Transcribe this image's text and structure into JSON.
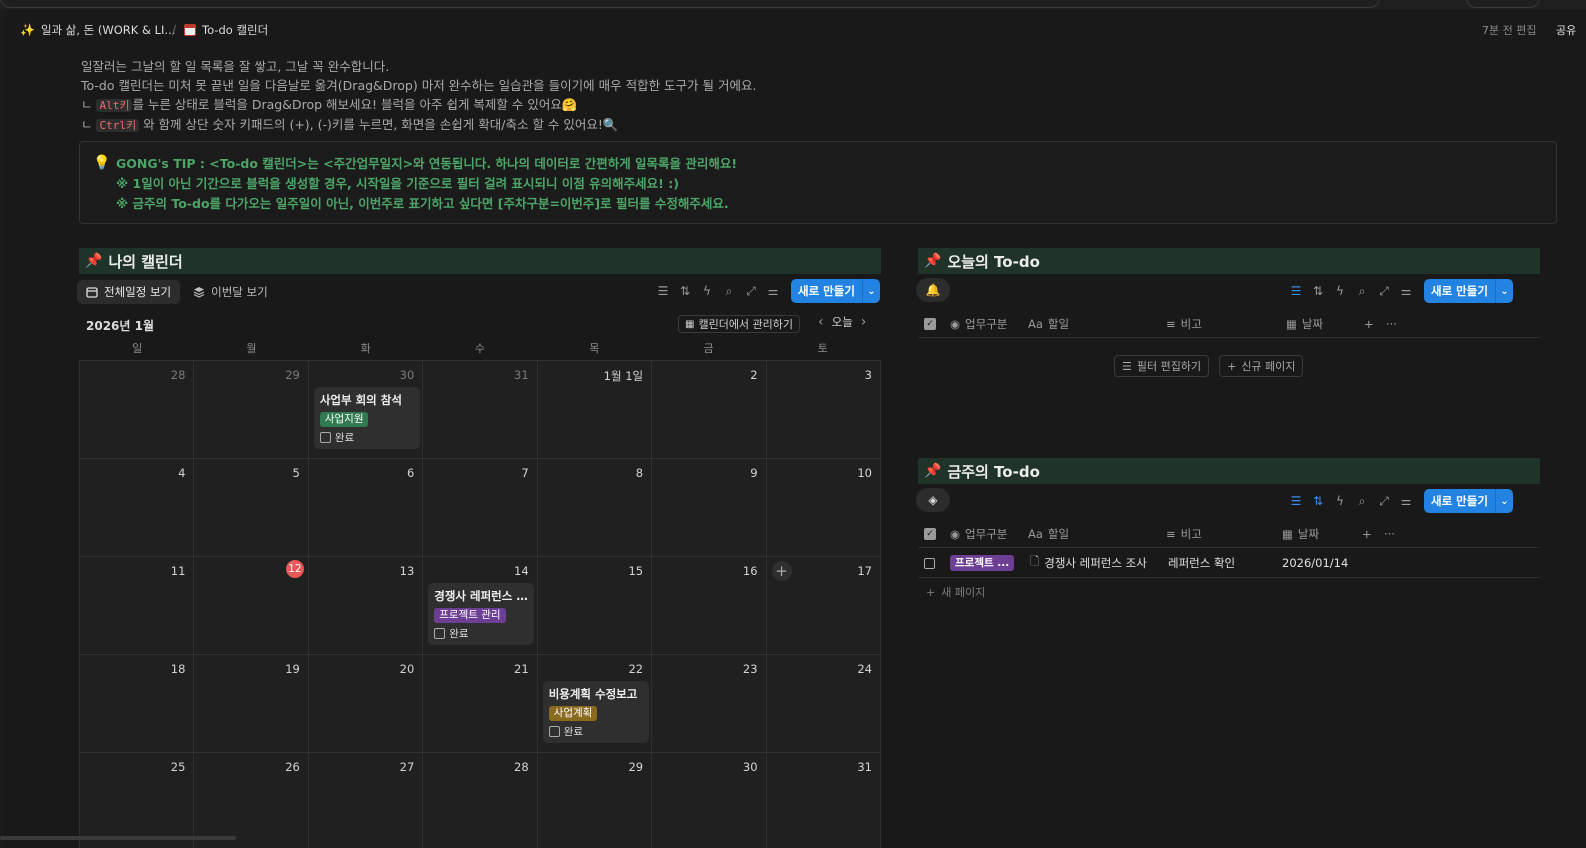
{
  "topbar": {
    "crumb_workspace": "일과 삶, 돈 (WORK & LI...",
    "crumb_sep": "/",
    "crumb_page": "To-do 캘린더",
    "edited": "7분 전 편집",
    "share": "공유"
  },
  "description": {
    "line1": "일잘러는 그날의 할 일 목록을 잘 쌓고, 그날 꼭 완수합니다.",
    "line2": "To-do 캘린더는 미처 못 끝낸 일을 다음날로 옮겨(Drag&Drop) 마저 완수하는 일습관을 들이기에 매우 적합한 도구가 될 거에요.",
    "line3_prefix": "ㄴ ",
    "line3_code": "Alt키",
    "line3_rest": "를 누른 상태로 블럭을 Drag&Drop 해보세요! 블럭을 아주 쉽게 복제할 수 있어요🤗",
    "line4_prefix": "ㄴ ",
    "line4_code": "Ctrl키",
    "line4_rest": " 와 함께 상단 숫자 키패드의 (+), (-)키를 누르면, 화면을 손쉽게 확대/축소 할 수 있어요!🔍"
  },
  "callout": {
    "line1": "GONG's TIP : <To-do 캘린더>는 <주간업무일지>와 연동됩니다. 하나의 데이터로 간편하게 일목록을 관리해요!",
    "line2": "※ 1일이 아닌 기간으로 블럭을 생성할 경우, 시작일을 기준으로 필터 걸려 표시되니 이점 유의해주세요! :)",
    "line3": "※ 금주의 To-do를 다가오는 일주일이 아닌, 이번주로 표기하고 싶다면 [주차구분=이번주]로 필터를 수정해주세요."
  },
  "calendar": {
    "heading": "나의 캘린더",
    "tab_all": "전체일정 보기",
    "tab_month": "이번달 보기",
    "new_button": "새로 만들기",
    "month_label": "2026년 1월",
    "manage_label": "캘린더에서 관리하기",
    "today_label": "오늘",
    "weekdays": [
      "일",
      "월",
      "화",
      "수",
      "목",
      "금",
      "토"
    ],
    "weeks": [
      [
        "28",
        "29",
        "30",
        "31",
        "1월 1일",
        "2",
        "3"
      ],
      [
        "4",
        "5",
        "6",
        "7",
        "8",
        "9",
        "10"
      ],
      [
        "11",
        "12",
        "13",
        "14",
        "15",
        "16",
        "17"
      ],
      [
        "18",
        "19",
        "20",
        "21",
        "22",
        "23",
        "24"
      ],
      [
        "25",
        "26",
        "27",
        "28",
        "29",
        "30",
        "31"
      ]
    ],
    "events": {
      "e1": {
        "title": "사업부 회의 참석",
        "tag": "사업지원",
        "tag_color": "#2f7a50",
        "done": "완료"
      },
      "e2": {
        "title": "경쟁사 레퍼런스 조사",
        "tag": "프로젝트 관리",
        "tag_color": "#6d3f94",
        "done": "완료"
      },
      "e3": {
        "title": "비용계획 수정보고",
        "tag": "사업계획",
        "tag_color": "#8a6a1e",
        "done": "완료"
      }
    }
  },
  "today_todo": {
    "heading": "오늘의 To-do",
    "new_button": "새로 만들기",
    "col_category": "업무구분",
    "col_task": "할일",
    "col_note": "비고",
    "col_date": "날짜",
    "filter_edit": "필터 편집하기",
    "new_page": "신규 페이지"
  },
  "week_todo": {
    "heading": "금주의 To-do",
    "new_button": "새로 만들기",
    "col_category": "업무구분",
    "col_task": "할일",
    "col_note": "비고",
    "col_date": "날짜",
    "row": {
      "category": "프로젝트 ...",
      "task": "경쟁사 레퍼런스 조사",
      "note": "레퍼런스 확인",
      "date": "2026/01/14"
    },
    "new_page": "새 페이지"
  },
  "colors": {
    "accent_blue": "#2383e2",
    "section_green": "#1f3328",
    "callout_text": "#4ca567",
    "today_red": "#eb5757"
  }
}
